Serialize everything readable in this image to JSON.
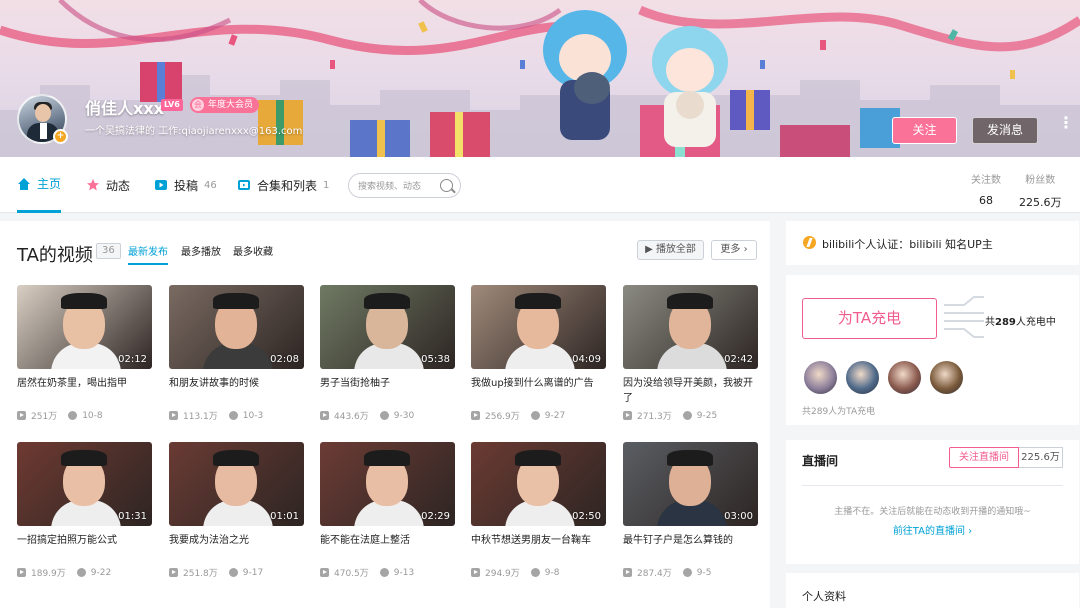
{
  "header": {
    "username": "俏佳人xxx",
    "level": "LV6",
    "vip_label": "年度大会员",
    "vip_icon_glyph": "会",
    "sign": "一个吴搞法律的 工作:qiaojiarenxxx@163.com",
    "verified_glyph": "+",
    "follow_label": "关注",
    "message_label": "发消息",
    "more_glyph": "⋮"
  },
  "nav": {
    "items": [
      {
        "label": "主页",
        "count": "",
        "icon": "home-icon",
        "color": "#00a1d6"
      },
      {
        "label": "动态",
        "count": "",
        "icon": "dynamic-icon",
        "color": "#fb7299"
      },
      {
        "label": "投稿",
        "count": "46",
        "icon": "upload-icon",
        "color": "#00a1d6"
      },
      {
        "label": "合集和列表",
        "count": "1",
        "icon": "playlist-icon",
        "color": "#00a1d6"
      }
    ],
    "search_placeholder": "搜索视频、动态",
    "stats": [
      {
        "label": "关注数",
        "value": "68"
      },
      {
        "label": "粉丝数",
        "value": "225.6万"
      }
    ]
  },
  "videos": {
    "title": "TA的视频",
    "count": "36",
    "sort_tabs": [
      "最新发布",
      "最多播放",
      "最多收藏"
    ],
    "play_all_label": "播放全部",
    "more_label": "更多",
    "items": [
      {
        "title": "居然在奶茶里，喝出指甲",
        "duration": "02:12",
        "plays": "251万",
        "date": "10-8",
        "bg": "#d9cfc4",
        "skin": "#e8c0a4",
        "shirt": "#f2f2f2"
      },
      {
        "title": "和朋友讲故事的时候",
        "duration": "02:08",
        "plays": "113.1万",
        "date": "10-3",
        "bg": "#7a6b62",
        "skin": "#e2b396",
        "shirt": "#3b3b3b"
      },
      {
        "title": "男子当街抢柚子",
        "duration": "05:38",
        "plays": "443.6万",
        "date": "9-30",
        "bg": "#6f7a63",
        "skin": "#d9b59a",
        "shirt": "#e8e8e8"
      },
      {
        "title": "我做up接到什么离谱的广告",
        "duration": "04:09",
        "plays": "256.9万",
        "date": "9-27",
        "bg": "#a08a7a",
        "skin": "#e6b89c",
        "shirt": "#eeeeee"
      },
      {
        "title": "因为没给领导开美颜，我被开了",
        "duration": "02:42",
        "plays": "271.3万",
        "date": "9-25",
        "bg": "#8b8b82",
        "skin": "#e1b59a",
        "shirt": "#dcdcdc"
      },
      {
        "title": "一招搞定拍照万能公式",
        "duration": "01:31",
        "plays": "189.9万",
        "date": "9-22",
        "bg": "#6e3a32",
        "skin": "#e9c0a6",
        "shirt": "#eeeeee"
      },
      {
        "title": "我要成为法治之光",
        "duration": "01:01",
        "plays": "251.8万",
        "date": "9-17",
        "bg": "#6a3b34",
        "skin": "#e6bba1",
        "shirt": "#eeeeee"
      },
      {
        "title": "能不能在法庭上整活",
        "duration": "02:29",
        "plays": "470.5万",
        "date": "9-13",
        "bg": "#6c3c35",
        "skin": "#e8bea4",
        "shirt": "#eeeeee"
      },
      {
        "title": "中秋节想送男朋友一台鞠车",
        "duration": "02:50",
        "plays": "294.9万",
        "date": "9-8",
        "bg": "#6b3b33",
        "skin": "#e9c1a7",
        "shirt": "#eeeeee"
      },
      {
        "title": "最牛钉子户是怎么算钱的",
        "duration": "03:00",
        "plays": "287.4万",
        "date": "9-5",
        "bg": "#5a5e63",
        "skin": "#deb196",
        "shirt": "#2a3442"
      }
    ]
  },
  "sidebar": {
    "cert_text": "bilibili个人认证：bilibili 知名UP主",
    "charge_button": "为TA充电",
    "charge_count_prefix": "共",
    "charge_count_num": "289",
    "charge_count_suffix": "人充电中",
    "charge_foot": "共289人为TA充电",
    "fans_colors": [
      "#8d7f9b",
      "#4f6a8a",
      "#8a5a4e",
      "#7a5a3a"
    ],
    "live_title": "直播间",
    "live_follow_label": "关注直播间",
    "live_fans": "225.6万",
    "live_msg": "主播不在。关注后就能在动态收到开播的通知哦~",
    "live_link": "前往TA的直播间 ›",
    "profile_title": "个人资料"
  }
}
